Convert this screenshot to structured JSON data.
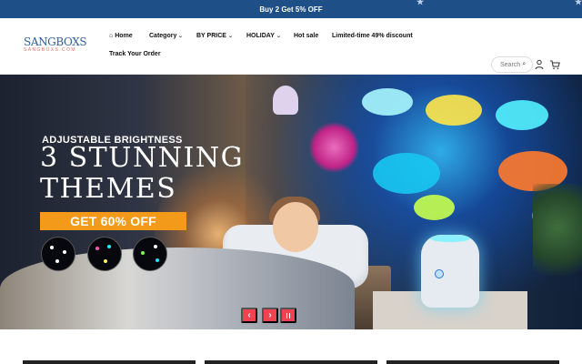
{
  "announcement": {
    "text": "Buy 2 Get 5% OFF"
  },
  "header": {
    "logo_main": "SANGBOXS",
    "logo_sub": "SANGBOXS.COM",
    "nav": {
      "home": "Home",
      "category": "Category",
      "by_price": "BY PRICE",
      "holiday": "HOLIDAY",
      "hot_sale": "Hot sale",
      "limited": "Limited-time 49% discount",
      "track": "Track Your Order"
    },
    "search": {
      "placeholder": "Search"
    }
  },
  "hero": {
    "small_title": "ADJUSTABLE BRIGHTNESS",
    "title_line_1": "3 STUNNING",
    "title_line_2": "THEMES",
    "offer": "GET 60% OFF"
  },
  "slider": {
    "prev": "‹",
    "next": "›"
  },
  "colors": {
    "announcement_bg": "#1f4f87",
    "offer": "#f39a1b",
    "slider_button": "#f0434f",
    "logo_blue": "#2f5f9c"
  },
  "icons": {
    "home": "home-icon",
    "search": "search-icon",
    "user": "user-icon",
    "cart": "cart-icon"
  }
}
